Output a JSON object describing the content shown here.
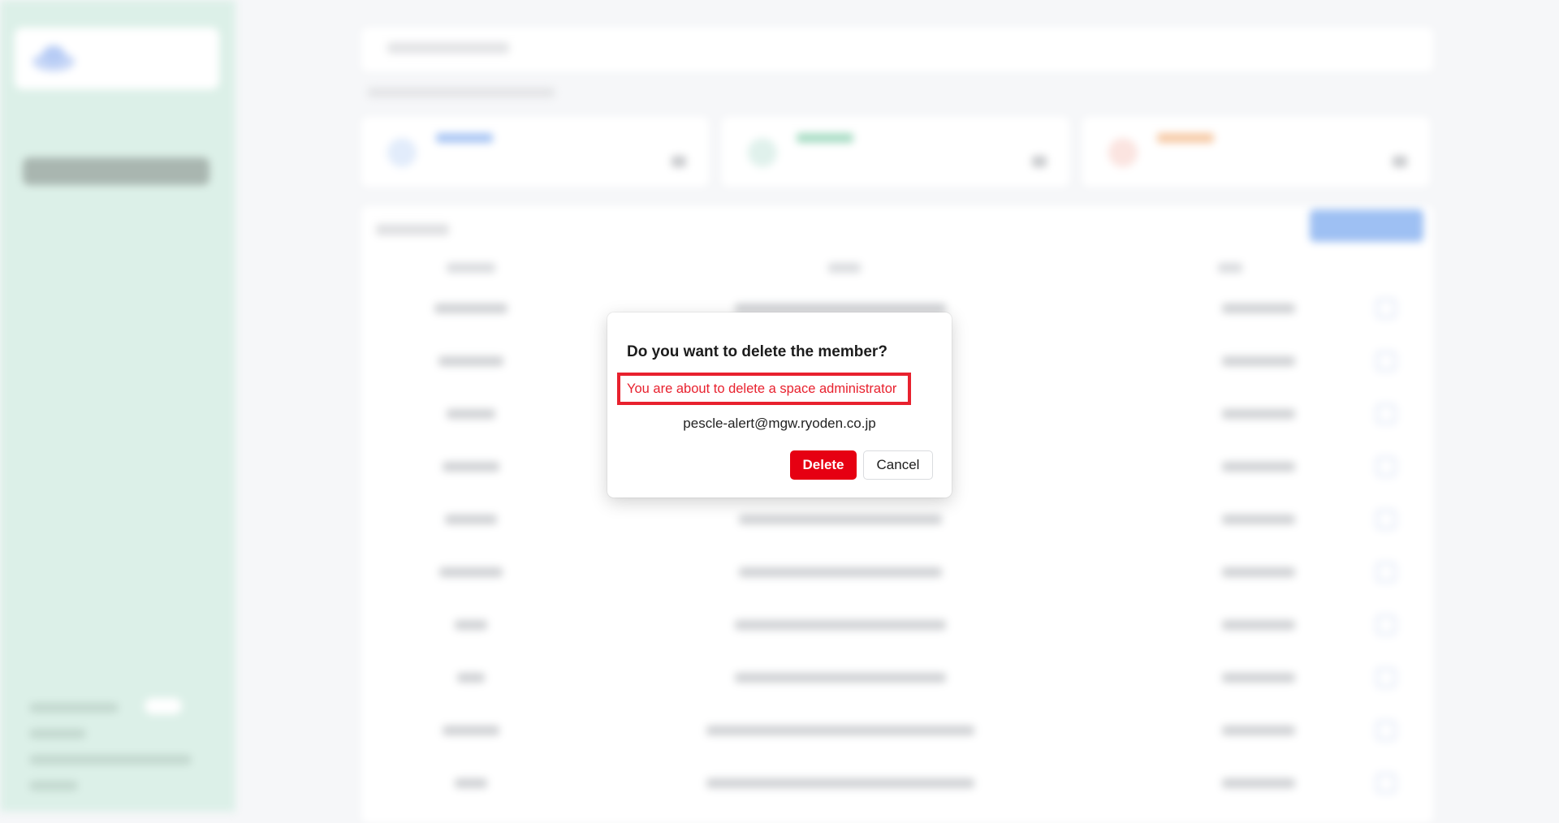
{
  "colors": {
    "danger": "#e60012",
    "warning_text": "#e8212e",
    "sidebar_bg": "#dcf0e8",
    "primary_blue": "#9ec0f3"
  },
  "dialog": {
    "title": "Do you want to delete the member?",
    "warning": "You are about to delete a space administrator",
    "email": "pescle-alert@mgw.ryoden.co.jp",
    "delete_label": "Delete",
    "cancel_label": "Cancel"
  }
}
